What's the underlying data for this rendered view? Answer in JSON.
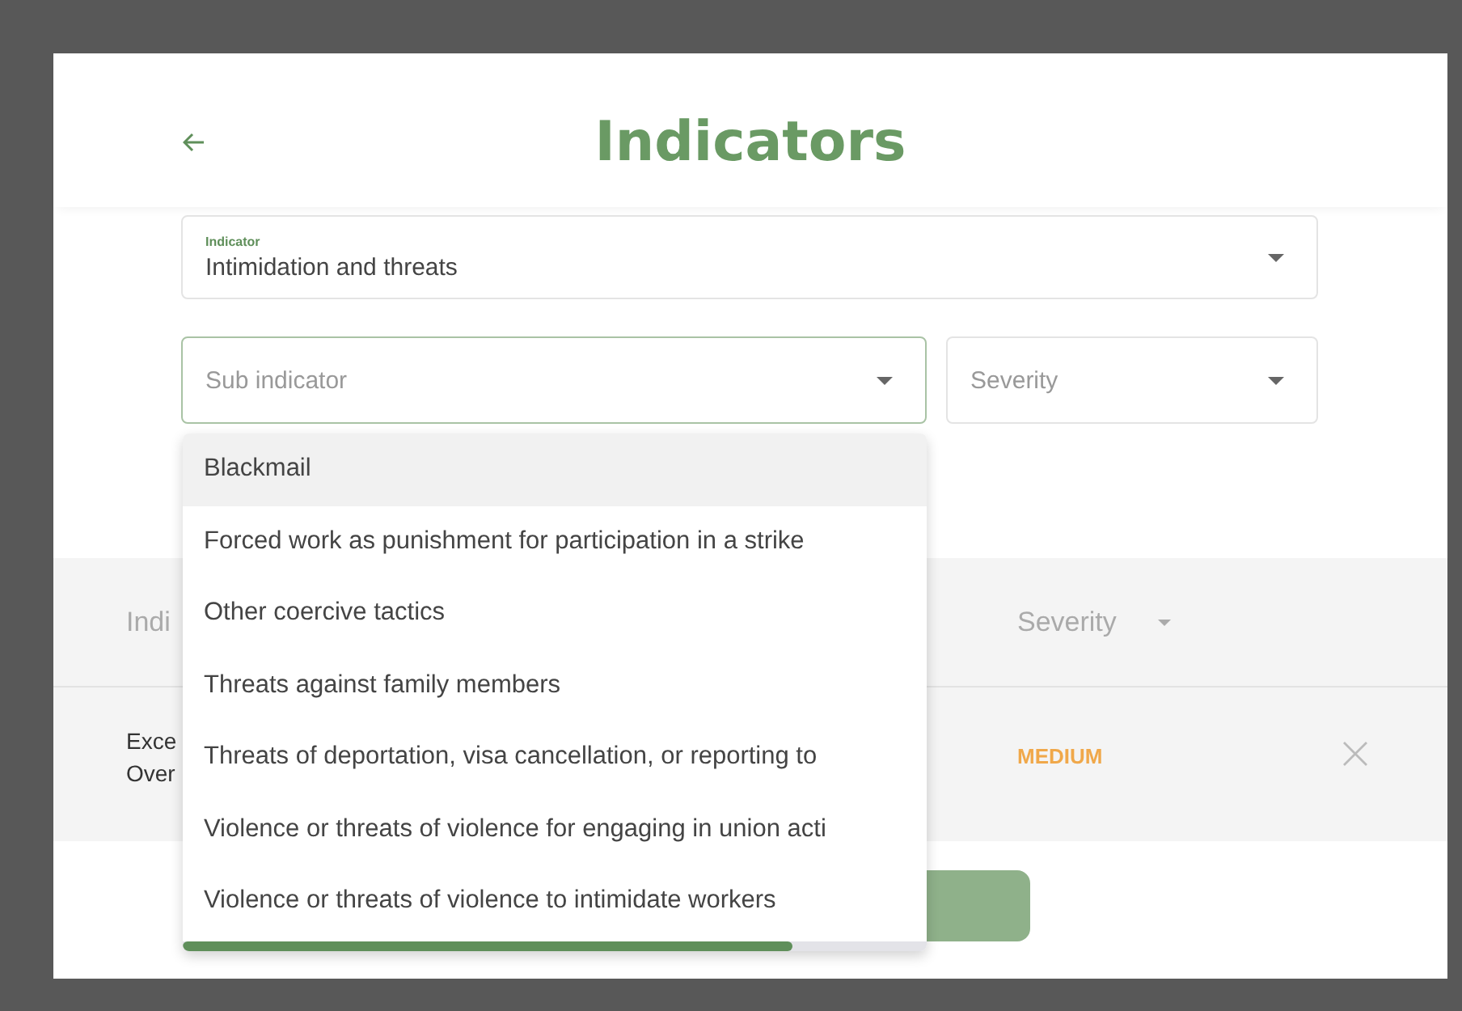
{
  "header": {
    "title": "Indicators"
  },
  "indicator_field": {
    "label": "Indicator",
    "value": "Intimidation and threats"
  },
  "sub_indicator_field": {
    "placeholder": "Sub indicator",
    "focused": true
  },
  "severity_field": {
    "placeholder": "Severity"
  },
  "table": {
    "columns": [
      "Indi",
      "Severity"
    ],
    "rows": [
      {
        "indicator": [
          "Exce",
          "Over"
        ],
        "severity": "MEDIUM"
      }
    ]
  },
  "dropdown": {
    "options": [
      {
        "label": "Blackmail",
        "highlighted": true
      },
      {
        "label": "Forced work as punishment for participation in a strike",
        "highlighted": false
      },
      {
        "label": "Other coercive tactics",
        "highlighted": false
      },
      {
        "label": "Threats against family members",
        "highlighted": false
      },
      {
        "label": "Threats of deportation, visa cancellation, or reporting to",
        "highlighted": false
      },
      {
        "label": "Violence or threats of violence for engaging in union acti",
        "highlighted": false
      },
      {
        "label": "Violence or threats of violence to intimidate workers",
        "highlighted": false
      }
    ]
  }
}
